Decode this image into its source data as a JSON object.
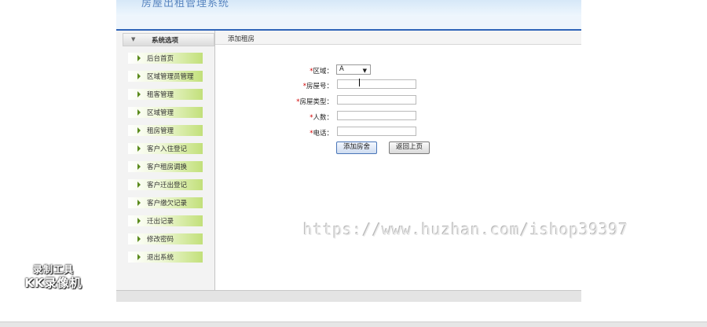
{
  "app": {
    "title": "房屋出租管理系统"
  },
  "sidebar": {
    "header": "系统选项",
    "items": [
      {
        "label": "后台首页"
      },
      {
        "label": "区域管理员管理"
      },
      {
        "label": "租客管理"
      },
      {
        "label": "区域管理"
      },
      {
        "label": "租房管理"
      },
      {
        "label": "客户入住登记"
      },
      {
        "label": "客户租房调换"
      },
      {
        "label": "客户迁出登记"
      },
      {
        "label": "客户缴欠记录"
      },
      {
        "label": "迁出记录"
      },
      {
        "label": "修改密码"
      },
      {
        "label": "退出系统"
      }
    ]
  },
  "breadcrumb": "添加租房",
  "form": {
    "region_label": "区域：",
    "region_value": "A",
    "room_no_label": "房屋号：",
    "room_type_label": "房屋类型：",
    "people_label": "人数：",
    "phone_label": "电话：",
    "required_mark": "*",
    "submit_label": "添加房舍",
    "back_label": "返回上页"
  },
  "overlay": {
    "watermark": "https://www.huzhan.com/ishop39397",
    "recorder_line1": "录制工具",
    "recorder_line2": "KK录像机"
  }
}
